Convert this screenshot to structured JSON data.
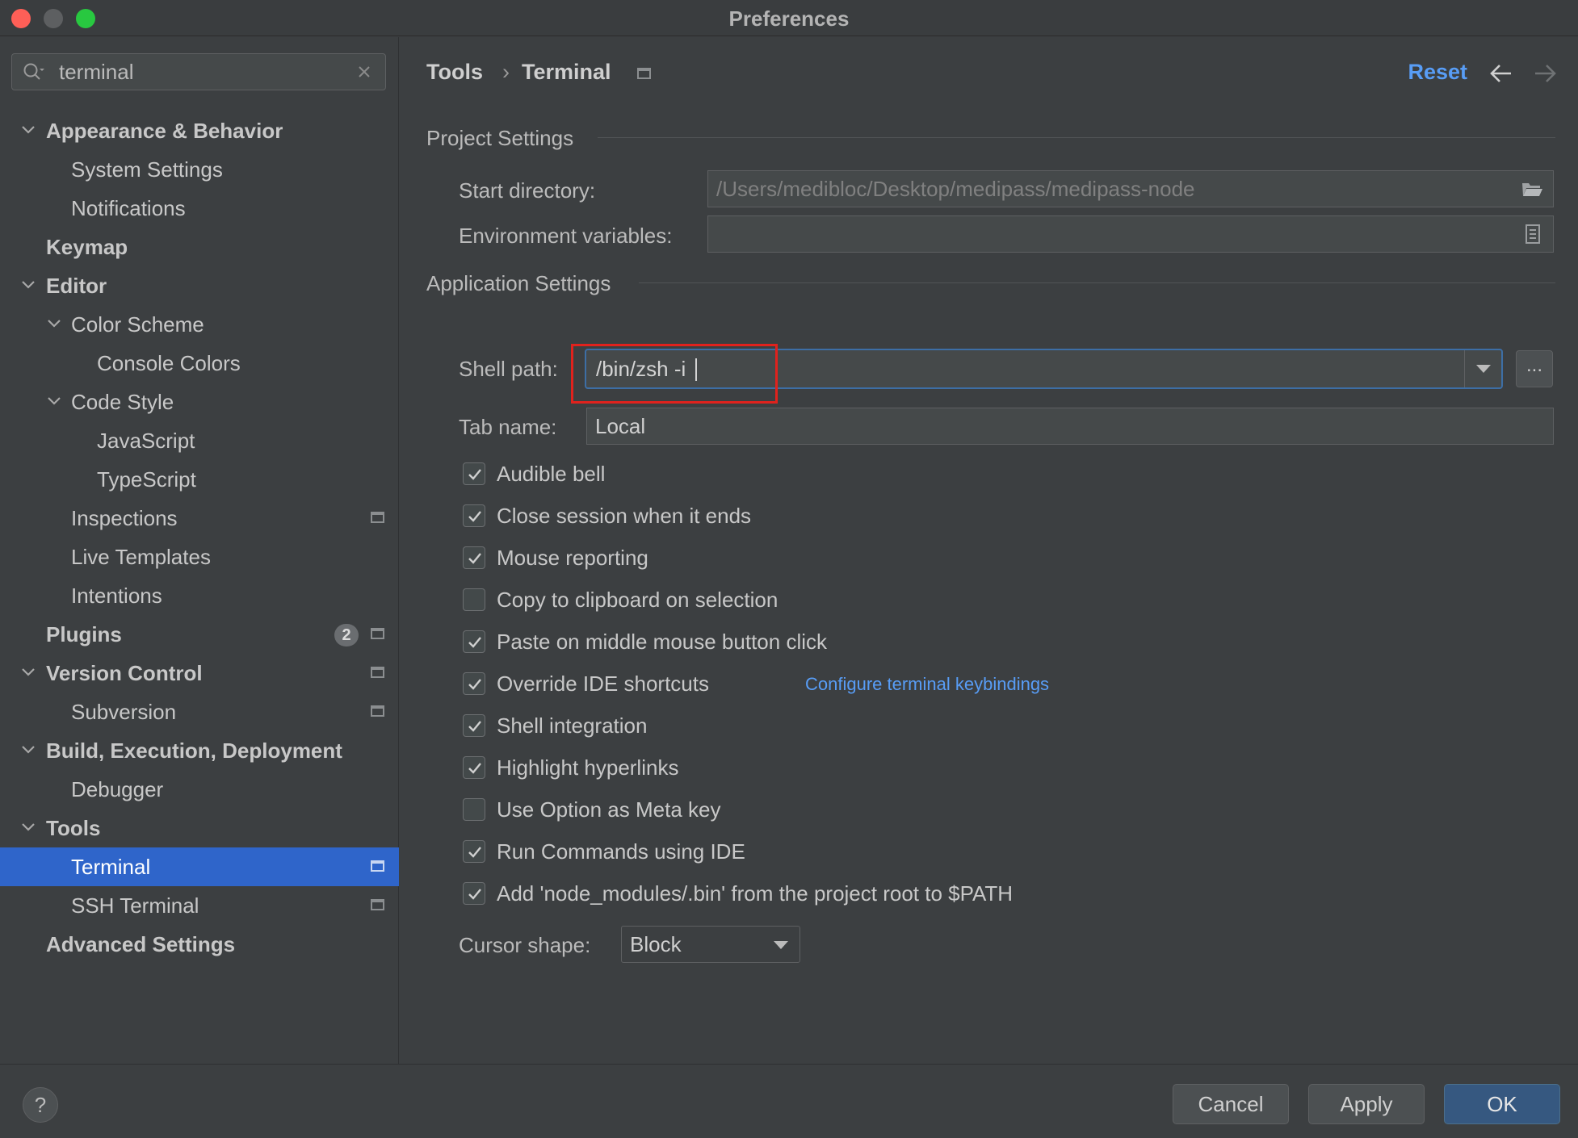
{
  "window": {
    "title": "Preferences"
  },
  "search": {
    "value": "terminal"
  },
  "tree": {
    "items": [
      {
        "label": "Appearance & Behavior",
        "bold": true
      },
      {
        "label": "System Settings"
      },
      {
        "label": "Notifications"
      },
      {
        "label": "Keymap",
        "bold": true
      },
      {
        "label": "Editor",
        "bold": true
      },
      {
        "label": "Color Scheme"
      },
      {
        "label": "Console Colors"
      },
      {
        "label": "Code Style"
      },
      {
        "label": "JavaScript"
      },
      {
        "label": "TypeScript"
      },
      {
        "label": "Inspections"
      },
      {
        "label": "Live Templates"
      },
      {
        "label": "Intentions"
      },
      {
        "label": "Plugins",
        "bold": true,
        "badge": "2"
      },
      {
        "label": "Version Control",
        "bold": true
      },
      {
        "label": "Subversion"
      },
      {
        "label": "Build, Execution, Deployment",
        "bold": true
      },
      {
        "label": "Debugger"
      },
      {
        "label": "Tools",
        "bold": true
      },
      {
        "label": "Terminal",
        "selected": true
      },
      {
        "label": "SSH Terminal"
      },
      {
        "label": "Advanced Settings",
        "bold": true
      }
    ]
  },
  "header": {
    "crumb_parent": "Tools",
    "crumb_separator": "›",
    "crumb_current": "Terminal",
    "reset_label": "Reset"
  },
  "project_settings": {
    "section_title": "Project Settings",
    "start_directory_label": "Start directory:",
    "start_directory_value": "/Users/medibloc/Desktop/medipass/medipass-node",
    "env_vars_label": "Environment variables:",
    "env_vars_value": ""
  },
  "app_settings": {
    "section_title": "Application Settings",
    "shell_path_label": "Shell path:",
    "shell_path_value": "/bin/zsh -i",
    "browse_label": "...",
    "tab_name_label": "Tab name:",
    "tab_name_value": "Local",
    "checkboxes": [
      {
        "label": "Audible bell",
        "checked": true
      },
      {
        "label": "Close session when it ends",
        "checked": true
      },
      {
        "label": "Mouse reporting",
        "checked": true
      },
      {
        "label": "Copy to clipboard on selection",
        "checked": false
      },
      {
        "label": "Paste on middle mouse button click",
        "checked": true
      },
      {
        "label": "Override IDE shortcuts",
        "checked": true
      },
      {
        "label": "Shell integration",
        "checked": true
      },
      {
        "label": "Highlight hyperlinks",
        "checked": true
      },
      {
        "label": "Use Option as Meta key",
        "checked": false
      },
      {
        "label": "Run Commands using IDE",
        "checked": true
      },
      {
        "label": "Add 'node_modules/.bin' from the project root to $PATH",
        "checked": true
      }
    ],
    "keybindings_link": "Configure terminal keybindings",
    "cursor_shape_label": "Cursor shape:",
    "cursor_shape_value": "Block"
  },
  "footer": {
    "help_label": "?",
    "cancel_label": "Cancel",
    "apply_label": "Apply",
    "ok_label": "OK"
  },
  "colors": {
    "accent": "#2f65ca",
    "link": "#589df6",
    "highlight_box": "#e0221d",
    "primary_button": "#365880"
  }
}
